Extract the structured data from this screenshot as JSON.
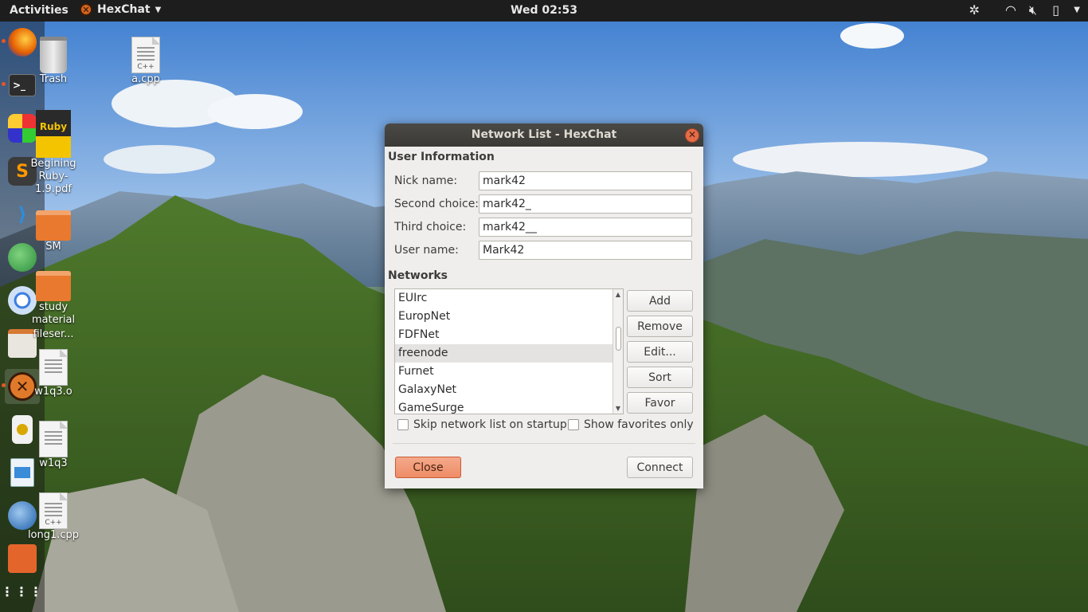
{
  "topbar": {
    "activities": "Activities",
    "app_name": "HexChat",
    "clock": "Wed 02:53",
    "tray_icons": [
      "accessibility-icon",
      "wifi-icon",
      "volume-muted-icon",
      "battery-icon",
      "menu-arrow-icon"
    ]
  },
  "dock": {
    "apps": [
      "firefox",
      "terminal",
      "app-center",
      "sublime-text",
      "vscode",
      "web-browser",
      "chromium",
      "files",
      "hexchat",
      "rhythmbox",
      "image-viewer",
      "thunderbird",
      "software-store",
      "show-apps"
    ]
  },
  "desktop": {
    "icons": [
      {
        "label": "Trash"
      },
      {
        "label": "a.cpp",
        "badge": "C++"
      },
      {
        "label": "Begining Ruby-1.9.pdf",
        "cover": "Ruby"
      },
      {
        "label": "SM"
      },
      {
        "label": "study material"
      },
      {
        "label": "fileser..."
      },
      {
        "label": "w1q3.o"
      },
      {
        "label": "w1q3"
      },
      {
        "label": "long1.cpp",
        "badge": "C++"
      }
    ]
  },
  "dialog": {
    "title": "Network List - HexChat",
    "user_info_title": "User Information",
    "fields": {
      "nick_label": "Nick name:",
      "nick_value": "mark42",
      "second_label": "Second choice:",
      "second_value": "mark42_",
      "third_label": "Third choice:",
      "third_value": "mark42__",
      "user_label": "User name:",
      "user_value": "Mark42"
    },
    "networks_title": "Networks",
    "networks": [
      "EUIrc",
      "EuropNet",
      "FDFNet",
      "freenode",
      "Furnet",
      "GalaxyNet",
      "GameSurge"
    ],
    "selected_network": "freenode",
    "buttons": {
      "add": "Add",
      "remove": "Remove",
      "edit": "Edit...",
      "sort": "Sort",
      "favor": "Favor"
    },
    "skip_label": "Skip network list on startup",
    "favorites_label": "Show favorites only",
    "close_label": "Close",
    "connect_label": "Connect",
    "accent_color": "#ee8c66"
  }
}
